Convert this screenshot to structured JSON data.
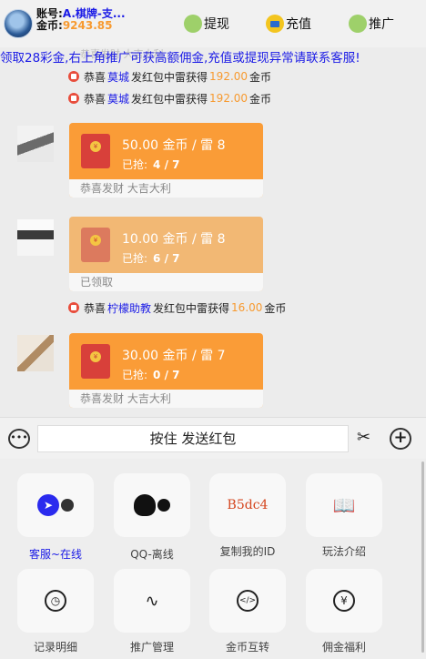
{
  "header": {
    "account_label": "账号:",
    "account_name": "A.棋牌-支...",
    "coins_label": "金币:",
    "coins_value": "9243.85",
    "withdraw": "提现",
    "recharge": "充值",
    "promote": "推广"
  },
  "marquee": "领取28彩金,右上角推广可获高额佣金,充值或提现异常请联系客服!",
  "ghost_text": "恭喜发财 大吉大利",
  "notices": [
    {
      "prefix": "恭喜",
      "who": "莫城",
      "mid": "发红包中雷获得",
      "amount": "192.00",
      "unit": "金币"
    },
    {
      "prefix": "恭喜",
      "who": "莫城",
      "mid": "发红包中雷获得",
      "amount": "192.00",
      "unit": "金币"
    },
    {
      "prefix": "恭喜",
      "who": "柠檬助教",
      "mid": "发红包中雷获得",
      "amount": "16.00",
      "unit": "金币"
    }
  ],
  "packets": [
    {
      "amount": "50.00 金币 / 雷 8",
      "grabbed_label": "已抢:",
      "grabbed": "4 / 7",
      "footer": "恭喜发财 大吉大利"
    },
    {
      "amount": "10.00 金币 / 雷 8",
      "grabbed_label": "已抢:",
      "grabbed": "6 / 7",
      "footer": "已领取"
    },
    {
      "amount": "30.00 金币 / 雷 7",
      "grabbed_label": "已抢:",
      "grabbed": "0 / 7",
      "footer": "恭喜发财 大吉大利"
    }
  ],
  "input": {
    "hold_label": "按住 发送红包"
  },
  "panel": [
    {
      "label": "客服~在线",
      "icon": "compass-icon"
    },
    {
      "label": "QQ-离线",
      "icon": "qq-icon"
    },
    {
      "label": "复制我的ID",
      "icon": "id-icon",
      "glyph": "B5dc4"
    },
    {
      "label": "玩法介绍",
      "icon": "book-icon"
    },
    {
      "label": "记录明细",
      "icon": "clock-icon"
    },
    {
      "label": "推广管理",
      "icon": "pulse-icon"
    },
    {
      "label": "金币互转",
      "icon": "code-icon"
    },
    {
      "label": "佣金福利",
      "icon": "yen-icon"
    }
  ],
  "colors": {
    "accent_blue": "#1a1ae6",
    "orange": "#fa9c37",
    "red_packet": "#d8403a"
  }
}
